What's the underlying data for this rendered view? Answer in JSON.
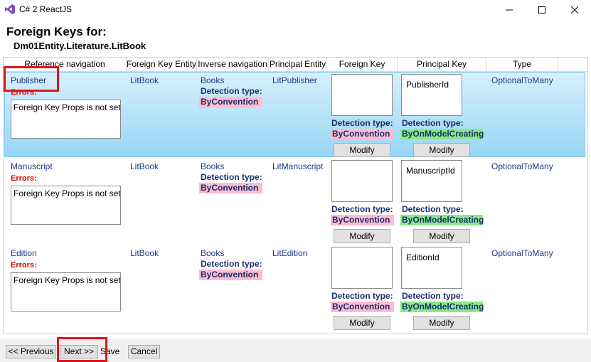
{
  "window": {
    "title": "C# 2 ReactJS",
    "controls": {
      "minimize": "—",
      "maximize": "☐",
      "close": "✕"
    }
  },
  "heading": "Foreign Keys for:",
  "subheading": "Dm01Entity.Literature.LitBook",
  "columns": [
    "Reference navigation",
    "Foreign Key Entity",
    "Inverse navigation",
    "Principal Entity",
    "Foreign Key",
    "Principal Key",
    "Type"
  ],
  "errors_label": "Errors:",
  "detection_label": "Detection type:",
  "modify_label": "Modify",
  "rows": [
    {
      "reference": "Publisher",
      "fk_entity": "LitBook",
      "inverse": "Books",
      "inverse_detection": "ByConvention",
      "principal_entity": "LitPublisher",
      "error_text": "Foreign Key Props is not set.",
      "foreign_key": "",
      "fk_detection": "ByConvention",
      "principal_key": "PublisherId",
      "pk_detection": "ByOnModelCreating",
      "type": "OptionalToMany"
    },
    {
      "reference": "Manuscript",
      "fk_entity": "LitBook",
      "inverse": "Books",
      "inverse_detection": "ByConvention",
      "principal_entity": "LitManuscript",
      "error_text": "Foreign Key Props is not set.",
      "foreign_key": "",
      "fk_detection": "ByConvention",
      "principal_key": "ManuscriptId",
      "pk_detection": "ByOnModelCreating",
      "type": "OptionalToMany"
    },
    {
      "reference": "Edition",
      "fk_entity": "LitBook",
      "inverse": "Books",
      "inverse_detection": "ByConvention",
      "principal_entity": "LitEdition",
      "error_text": "Foreign Key Props is not set.",
      "foreign_key": "",
      "fk_detection": "ByConvention",
      "principal_key": "EditionId",
      "pk_detection": "ByOnModelCreating",
      "type": "OptionalToMany"
    }
  ],
  "footer": {
    "previous": "<< Previous",
    "next": "Next >>",
    "save": "Save",
    "cancel": "Cancel"
  },
  "colors": {
    "accent_highlight": "#e0141c",
    "selected_row": "#98d6f4",
    "error_text": "#e00000",
    "convention_tag": "#ffbcd1",
    "model_creating_tag": "#86eb88"
  }
}
